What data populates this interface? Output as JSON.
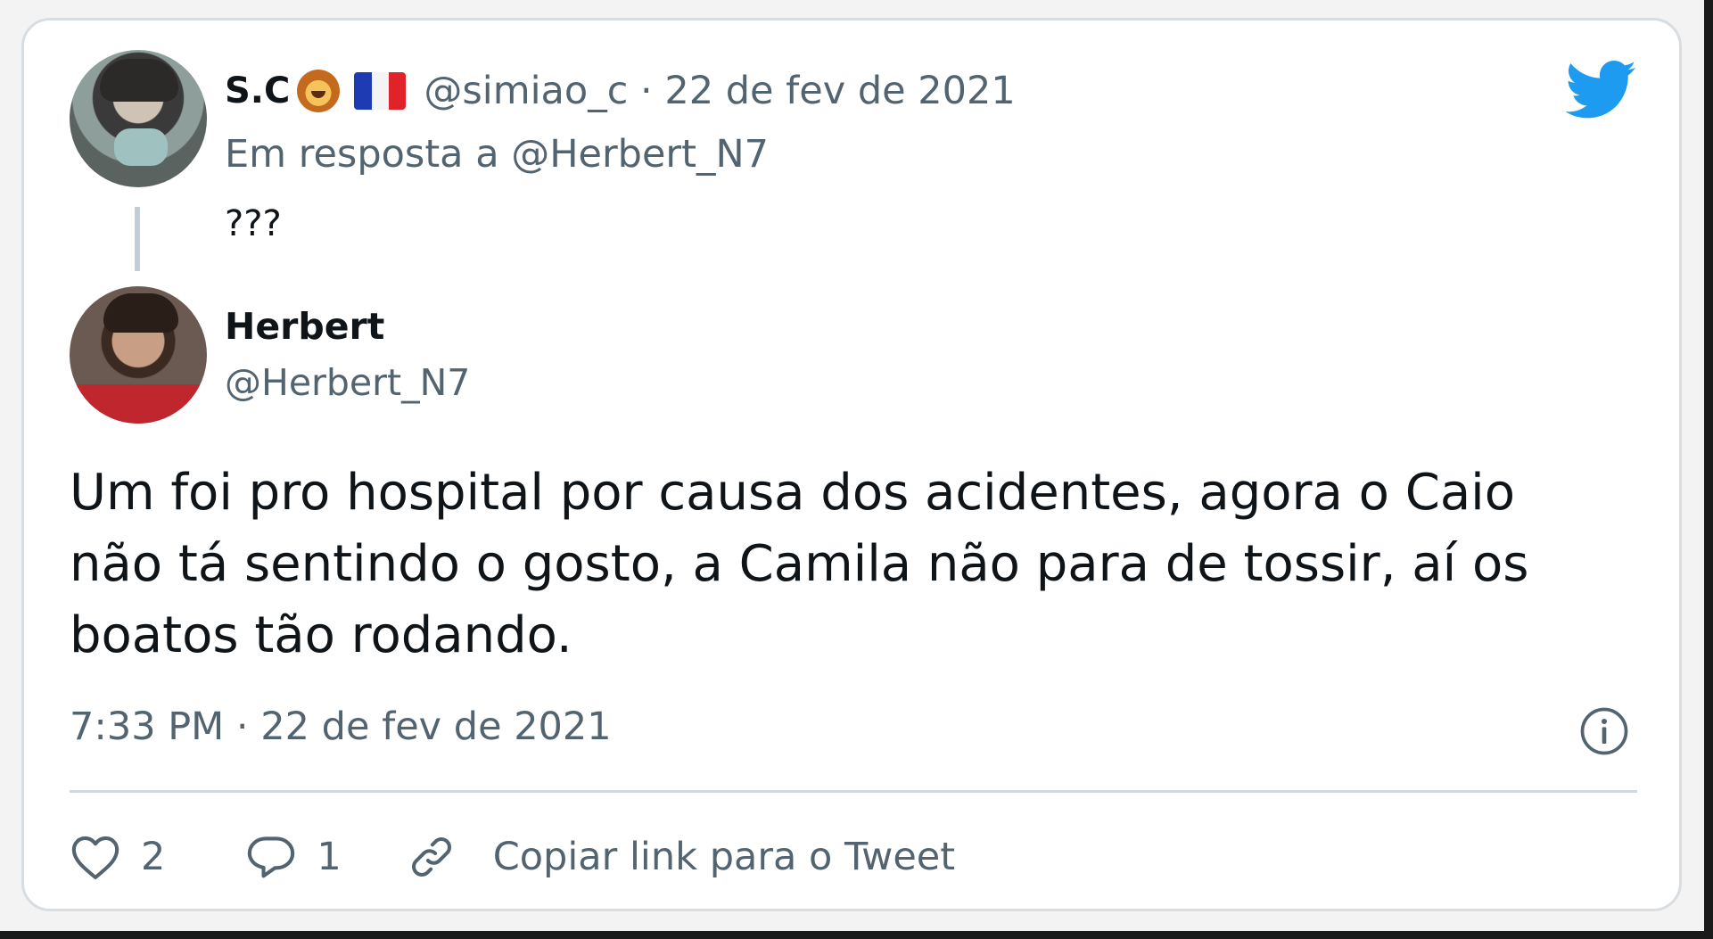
{
  "reply_tweet": {
    "author_name": "S.C",
    "emoji": "lion-face-emoji",
    "flag": "france-flag",
    "handle_line": "@simiao_c · 22 de fev de 2021",
    "reply_to": "Em resposta a @Herbert_N7",
    "text": "???"
  },
  "main_tweet": {
    "author_name": "Herbert",
    "handle": "@Herbert_N7",
    "text": "Um foi pro hospital por causa dos acidentes, agora o Caio não tá sentindo o gosto, a Camila não para de tossir, aí os boatos tão rodando.",
    "timestamp": "7:33 PM · 22 de fev de 2021"
  },
  "actions": {
    "like_count": "2",
    "reply_count": "1",
    "copy_link_label": "Copiar link para o Tweet"
  },
  "icons": {
    "brand": "twitter-bird-icon",
    "info": "info-icon",
    "like": "heart-icon",
    "reply": "speech-bubble-icon",
    "link": "link-icon"
  },
  "colors": {
    "twitter_blue": "#1d9bf0",
    "secondary_text": "#536471",
    "primary_text": "#0f1419",
    "border": "#d8dde1"
  }
}
